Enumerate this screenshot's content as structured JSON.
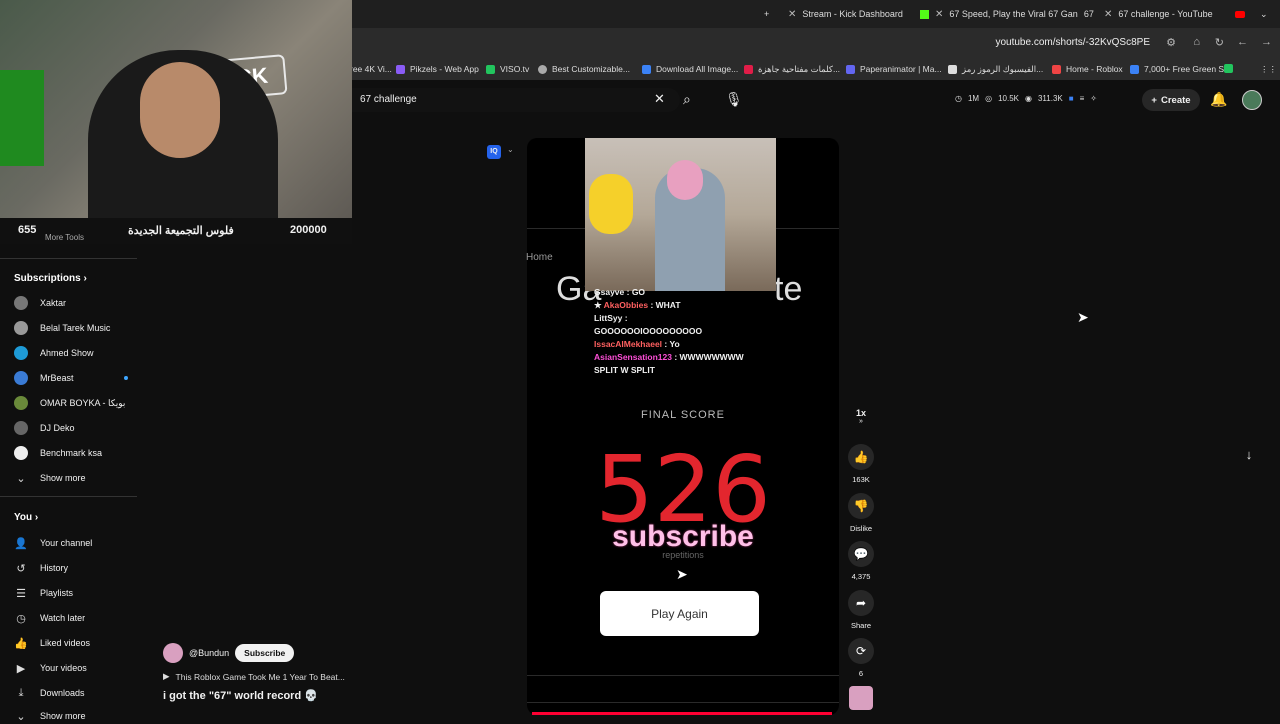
{
  "browser": {
    "tabs": [
      {
        "label": "Stream - Kick Dashboard"
      },
      {
        "label": "67 Speed, Play the Viral 67 Gan",
        "suffix": "67"
      },
      {
        "label": "67 challenge - YouTube"
      }
    ],
    "url": "youtube.com/shorts/-32KvQSc8PE",
    "bookmarks": [
      {
        "label": "ree 4K Vi..."
      },
      {
        "label": "Pikzels - Web App"
      },
      {
        "label": "VISO.tv"
      },
      {
        "label": "Best Customizable..."
      },
      {
        "label": "Download All Image..."
      },
      {
        "label": "كلمات مفتاحية جاهزة..."
      },
      {
        "label": "Paperanimator | Ma..."
      },
      {
        "label": "الفيسبوك الرموز رمز..."
      },
      {
        "label": "Home - Roblox"
      },
      {
        "label": "7,000+ Free Green S..."
      }
    ]
  },
  "webcam": {
    "count": "655",
    "tools": "More Tools",
    "title": "فلوس التجميعة الجديدة",
    "goal": "200000",
    "sign": "KICK"
  },
  "youtube": {
    "search": "67 challenge",
    "stats": {
      "a": "1M",
      "b": "10.5K",
      "c": "311.3K"
    },
    "create": "Create"
  },
  "sidebar": {
    "subscriptions_title": "Subscriptions",
    "subscriptions": [
      {
        "label": "Xaktar",
        "color": "#777"
      },
      {
        "label": "Belal Tarek Music",
        "color": "#999"
      },
      {
        "label": "Ahmed Show",
        "color": "#1e9bd7"
      },
      {
        "label": "MrBeast",
        "color": "#3a7bd5"
      },
      {
        "label": "OMAR BOYKA - بويكا",
        "color": "#6a8a3a"
      },
      {
        "label": "DJ Deko",
        "color": "#666"
      },
      {
        "label": "Benchmark ksa",
        "color": "#eee"
      }
    ],
    "show_more": "Show more",
    "you_title": "You",
    "you_items": [
      {
        "label": "Your channel"
      },
      {
        "label": "History"
      },
      {
        "label": "Playlists"
      },
      {
        "label": "Watch later"
      },
      {
        "label": "Liked videos"
      },
      {
        "label": "Your videos"
      },
      {
        "label": "Downloads"
      }
    ],
    "show_more_2": "Show more"
  },
  "short": {
    "home_bg": "Home",
    "game_left": "Ga",
    "game_right": "te",
    "chat": [
      {
        "name": "Gsayve",
        "text": ": GO",
        "cls": ""
      },
      {
        "name": "AkaObbies",
        "text": ": WHAT",
        "cls": "n1"
      },
      {
        "name": "LittSyy",
        "text": ":",
        "cls": ""
      },
      {
        "name": "",
        "text": "GOOOOOOIOOOOOOOOO",
        "cls": ""
      },
      {
        "name": "IssacAlMekhaeel",
        "text": ": Yo",
        "cls": "n1"
      },
      {
        "name": "AsianSensation123",
        "text": ": WWWWWWWW",
        "cls": "n2"
      },
      {
        "name": "",
        "text": "SPLIT W SPLIT",
        "cls": ""
      }
    ],
    "final_label": "FINAL SCORE",
    "score": "526",
    "subscribe_overlay": "subscribe",
    "repetitions": "repetitions",
    "play_again": "Play Again",
    "progress": 0.96
  },
  "actions": {
    "speed": "1x",
    "likes": "163K",
    "dislike": "Dislike",
    "comments": "4,375",
    "share": "Share",
    "remix": "6"
  },
  "video_info": {
    "channel": "@Bundun",
    "subscribe": "Subscribe",
    "related": "This Roblox Game Took Me 1 Year To Beat...",
    "title": "i got the \"67\" world record 💀"
  }
}
